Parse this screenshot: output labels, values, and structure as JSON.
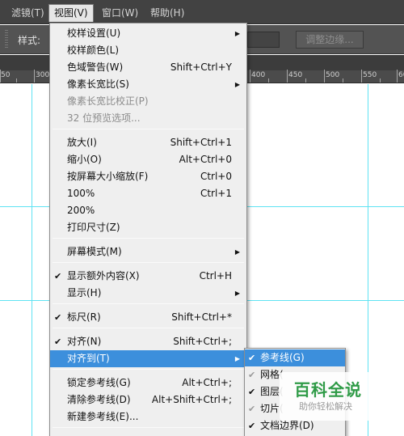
{
  "menubar": {
    "items": [
      "滤镜(T)",
      "视图(V)",
      "窗口(W)",
      "帮助(H)"
    ]
  },
  "options": {
    "style_label": "样式:",
    "refine_edge_label": "调整边缘..."
  },
  "ruler": {
    "labels": [
      "50",
      "300",
      "350",
      "400",
      "450",
      "500",
      "550",
      "600",
      "650",
      "700"
    ]
  },
  "view_menu": {
    "items": [
      {
        "label": "校样设置(U)",
        "shortcut": "",
        "submenu": true
      },
      {
        "label": "校样颜色(L)",
        "shortcut": ""
      },
      {
        "label": "色域警告(W)",
        "shortcut": "Shift+Ctrl+Y"
      },
      {
        "label": "像素长宽比(S)",
        "shortcut": "",
        "submenu": true
      },
      {
        "label": "像素长宽比校正(P)",
        "shortcut": "",
        "disabled": true
      },
      {
        "label": "32 位预览选项...",
        "shortcut": "",
        "disabled": true
      },
      {
        "label": "放大(I)",
        "shortcut": "Shift+Ctrl+1"
      },
      {
        "label": "缩小(O)",
        "shortcut": "Alt+Ctrl+0"
      },
      {
        "label": "按屏幕大小缩放(F)",
        "shortcut": "Ctrl+0"
      },
      {
        "label": "100%",
        "shortcut": "Ctrl+1"
      },
      {
        "label": "200%",
        "shortcut": ""
      },
      {
        "label": "打印尺寸(Z)",
        "shortcut": ""
      },
      {
        "label": "屏幕模式(M)",
        "shortcut": "",
        "submenu": true
      },
      {
        "label": "显示额外内容(X)",
        "shortcut": "Ctrl+H",
        "checked": true
      },
      {
        "label": "显示(H)",
        "shortcut": "",
        "submenu": true
      },
      {
        "label": "标尺(R)",
        "shortcut": "Shift+Ctrl+*",
        "checked": true
      },
      {
        "label": "对齐(N)",
        "shortcut": "Shift+Ctrl+;",
        "checked": true
      },
      {
        "label": "对齐到(T)",
        "shortcut": "",
        "submenu": true,
        "highlighted": true
      },
      {
        "label": "锁定参考线(G)",
        "shortcut": "Alt+Ctrl+;"
      },
      {
        "label": "清除参考线(D)",
        "shortcut": "Alt+Shift+Ctrl+;"
      },
      {
        "label": "新建参考线(E)...",
        "shortcut": ""
      }
    ]
  },
  "snap_submenu": {
    "items": [
      {
        "label": "参考线(G)",
        "checked": true,
        "highlighted": true
      },
      {
        "label": "网格(",
        "checked": false
      },
      {
        "label": "图层(",
        "checked": true
      },
      {
        "label": "切片(",
        "checked": true
      },
      {
        "label": "文档边界(D)",
        "checked": true
      }
    ]
  },
  "watermark": {
    "title": "百科全说",
    "subtitle": "助你轻松解决"
  },
  "colors": {
    "menubar_bg": "#424242",
    "menu_bg": "#efefef",
    "highlight": "#3c8fdc",
    "guide": "#5fe3f3",
    "watermark_green": "#2f9b47"
  }
}
